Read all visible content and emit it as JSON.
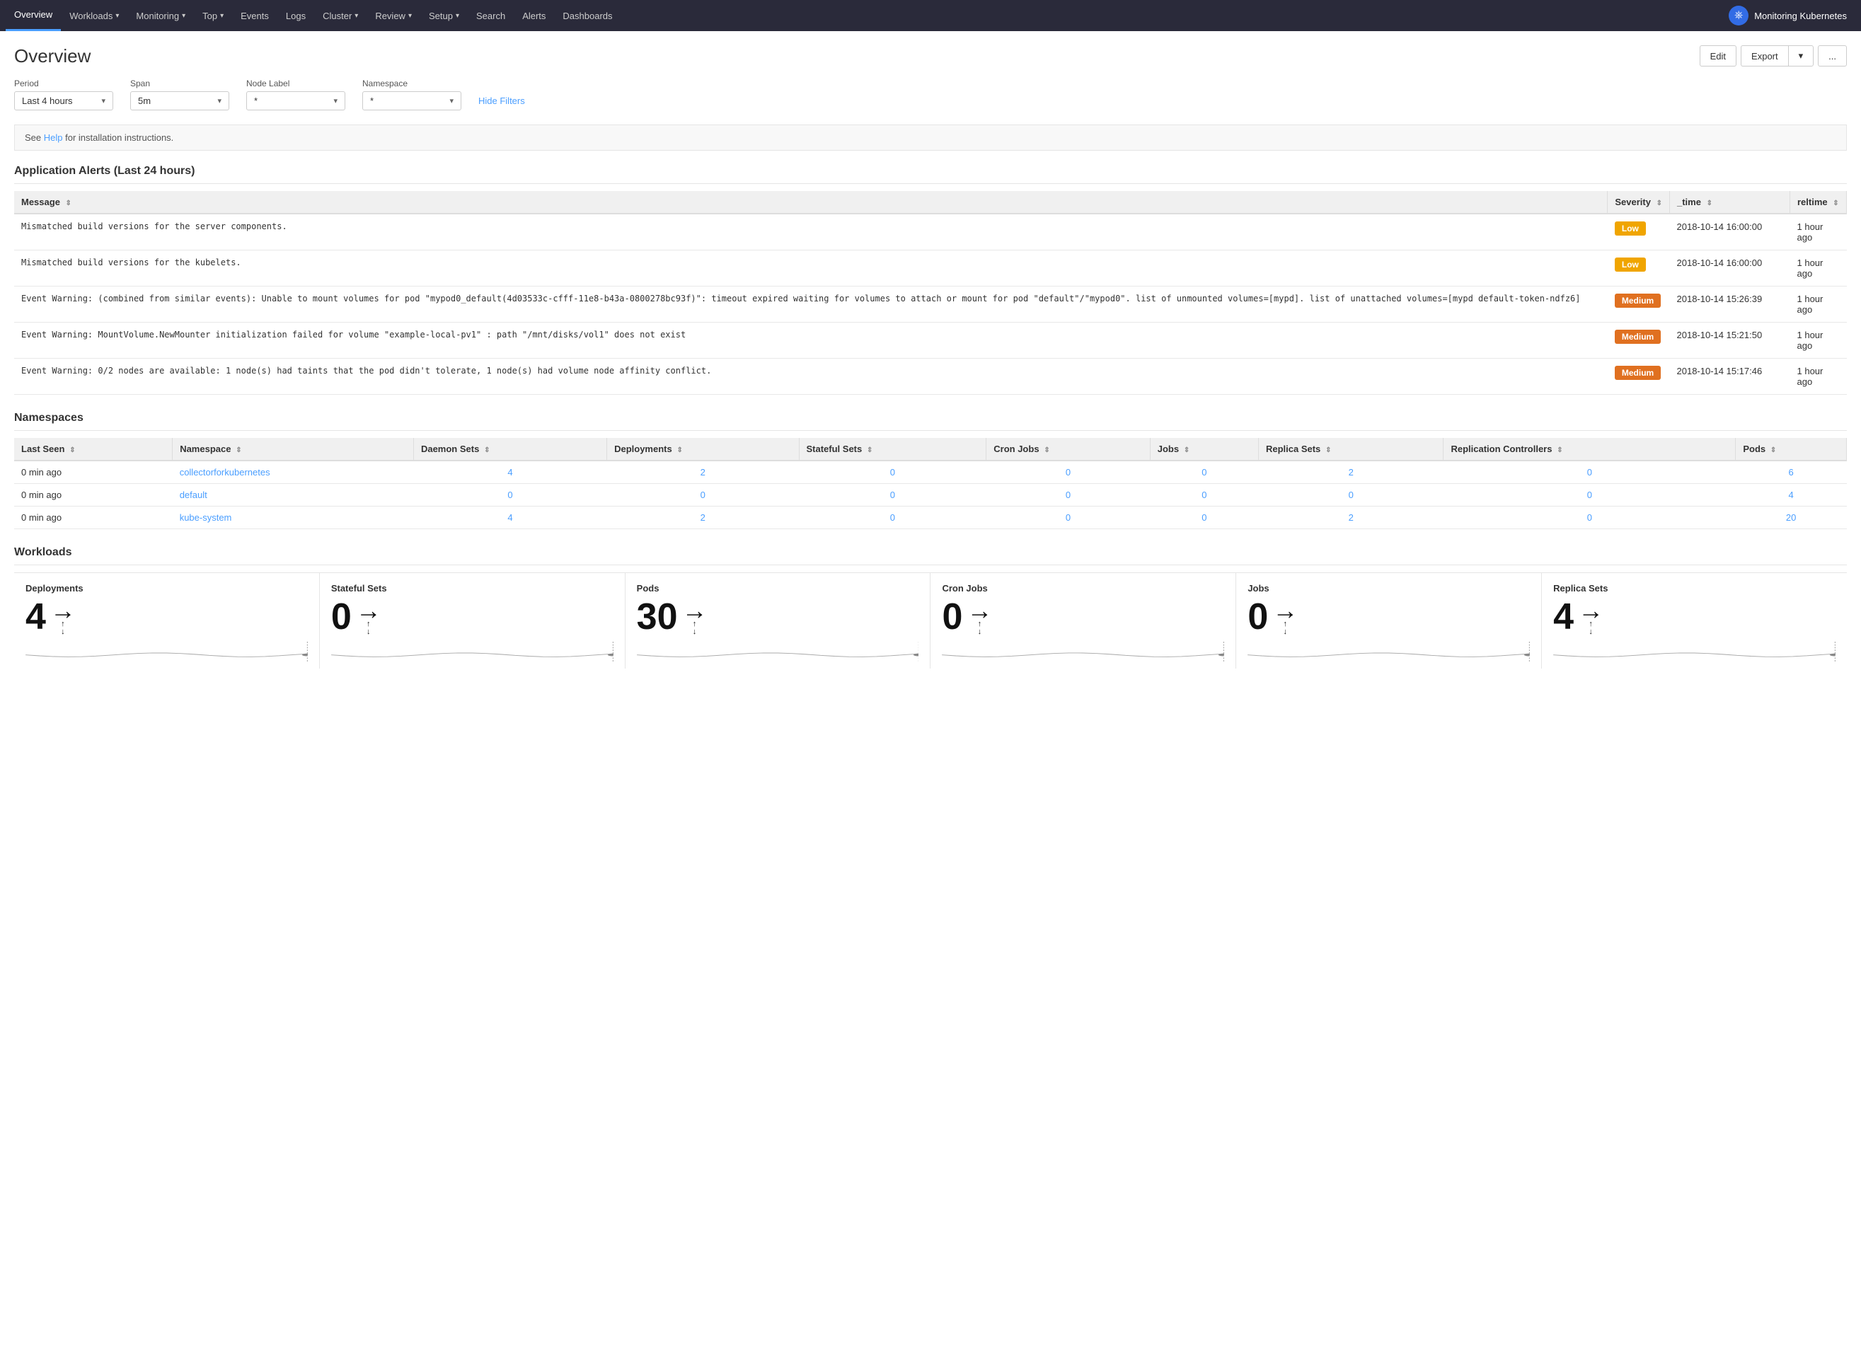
{
  "nav": {
    "items": [
      {
        "label": "Overview",
        "active": true,
        "hasCaret": false
      },
      {
        "label": "Workloads",
        "active": false,
        "hasCaret": true
      },
      {
        "label": "Monitoring",
        "active": false,
        "hasCaret": true
      },
      {
        "label": "Top",
        "active": false,
        "hasCaret": true
      },
      {
        "label": "Events",
        "active": false,
        "hasCaret": false
      },
      {
        "label": "Logs",
        "active": false,
        "hasCaret": false
      },
      {
        "label": "Cluster",
        "active": false,
        "hasCaret": true
      },
      {
        "label": "Review",
        "active": false,
        "hasCaret": true
      },
      {
        "label": "Setup",
        "active": false,
        "hasCaret": true
      },
      {
        "label": "Search",
        "active": false,
        "hasCaret": false
      },
      {
        "label": "Alerts",
        "active": false,
        "hasCaret": false
      },
      {
        "label": "Dashboards",
        "active": false,
        "hasCaret": false
      }
    ],
    "brand": "Monitoring Kubernetes",
    "brand_icon": "⎈"
  },
  "page": {
    "title": "Overview",
    "edit_label": "Edit",
    "export_label": "Export",
    "more_label": "..."
  },
  "filters": {
    "period_label": "Period",
    "period_value": "Last 4 hours",
    "span_label": "Span",
    "span_value": "5m",
    "node_label_label": "Node Label",
    "node_label_value": "*",
    "namespace_label": "Namespace",
    "namespace_value": "*",
    "hide_filters": "Hide Filters"
  },
  "info_bar": {
    "text_before": "See ",
    "link_text": "Help",
    "text_after": " for installation instructions."
  },
  "alerts": {
    "section_title": "Application Alerts (Last 24 hours)",
    "columns": [
      {
        "label": "Message",
        "sort": true
      },
      {
        "label": "Severity",
        "sort": true
      },
      {
        "label": "_time",
        "sort": true
      },
      {
        "label": "reltime",
        "sort": true
      }
    ],
    "rows": [
      {
        "message": "Mismatched build versions for the server components.",
        "severity": "Low",
        "severity_class": "low",
        "time": "2018-10-14 16:00:00",
        "reltime": "1 hour ago"
      },
      {
        "message": "Mismatched build versions for the kubelets.",
        "severity": "Low",
        "severity_class": "low",
        "time": "2018-10-14 16:00:00",
        "reltime": "1 hour ago"
      },
      {
        "message": "Event Warning: (combined from similar events): Unable to mount volumes for pod \"mypod0_default(4d03533c-cfff-11e8-b43a-0800278bc93f)\": timeout expired waiting for volumes to attach or mount for pod \"default\"/\"mypod0\". list of unmounted volumes=[mypd]. list of unattached volumes=[mypd default-token-ndfz6]",
        "severity": "Medium",
        "severity_class": "medium",
        "time": "2018-10-14 15:26:39",
        "reltime": "1 hour ago"
      },
      {
        "message": "Event Warning: MountVolume.NewMounter initialization failed for volume \"example-local-pv1\" : path \"/mnt/disks/vol1\" does not exist",
        "severity": "Medium",
        "severity_class": "medium",
        "time": "2018-10-14 15:21:50",
        "reltime": "1 hour ago"
      },
      {
        "message": "Event Warning: 0/2 nodes are available: 1 node(s) had taints that the pod didn't tolerate, 1 node(s) had volume node affinity conflict.",
        "severity": "Medium",
        "severity_class": "medium",
        "time": "2018-10-14 15:17:46",
        "reltime": "1 hour ago"
      }
    ]
  },
  "namespaces": {
    "section_title": "Namespaces",
    "columns": [
      {
        "label": "Last Seen",
        "sort": true
      },
      {
        "label": "Namespace",
        "sort": true
      },
      {
        "label": "Daemon Sets",
        "sort": true
      },
      {
        "label": "Deployments",
        "sort": true
      },
      {
        "label": "Stateful Sets",
        "sort": true
      },
      {
        "label": "Cron Jobs",
        "sort": true
      },
      {
        "label": "Jobs",
        "sort": true
      },
      {
        "label": "Replica Sets",
        "sort": true
      },
      {
        "label": "Replication Controllers",
        "sort": true
      },
      {
        "label": "Pods",
        "sort": true
      }
    ],
    "rows": [
      {
        "last_seen": "0 min ago",
        "namespace": "collectorforkubernetes",
        "daemon_sets": 4,
        "deployments": 2,
        "stateful_sets": 0,
        "cron_jobs": 0,
        "jobs": 0,
        "replica_sets": 2,
        "replication_controllers": 0,
        "pods": 6
      },
      {
        "last_seen": "0 min ago",
        "namespace": "default",
        "daemon_sets": 0,
        "deployments": 0,
        "stateful_sets": 0,
        "cron_jobs": 0,
        "jobs": 0,
        "replica_sets": 0,
        "replication_controllers": 0,
        "pods": 4
      },
      {
        "last_seen": "0 min ago",
        "namespace": "kube-system",
        "daemon_sets": 4,
        "deployments": 2,
        "stateful_sets": 0,
        "cron_jobs": 0,
        "jobs": 0,
        "replica_sets": 2,
        "replication_controllers": 0,
        "pods": 20
      }
    ]
  },
  "workloads": {
    "section_title": "Workloads",
    "items": [
      {
        "label": "Deployments",
        "count": "4",
        "up": "→",
        "up_top": "↑",
        "up_bottom": "↓"
      },
      {
        "label": "Stateful Sets",
        "count": "0",
        "up": "→",
        "up_top": "↑",
        "up_bottom": "↓"
      },
      {
        "label": "Pods",
        "count": "30",
        "up": "→",
        "up_top": "↑",
        "up_bottom": "↓"
      },
      {
        "label": "Cron Jobs",
        "count": "0",
        "up": "→",
        "up_top": "↑",
        "up_bottom": "↓"
      },
      {
        "label": "Jobs",
        "count": "0",
        "up": "→",
        "up_top": "↑",
        "up_bottom": "↓"
      },
      {
        "label": "Replica Sets",
        "count": "4",
        "up": "→",
        "up_top": "↑",
        "up_bottom": "↓"
      }
    ]
  },
  "colors": {
    "severity_low": "#f0a500",
    "severity_medium": "#e07020",
    "link": "#4a9eff",
    "nav_bg": "#2a2a3a"
  }
}
